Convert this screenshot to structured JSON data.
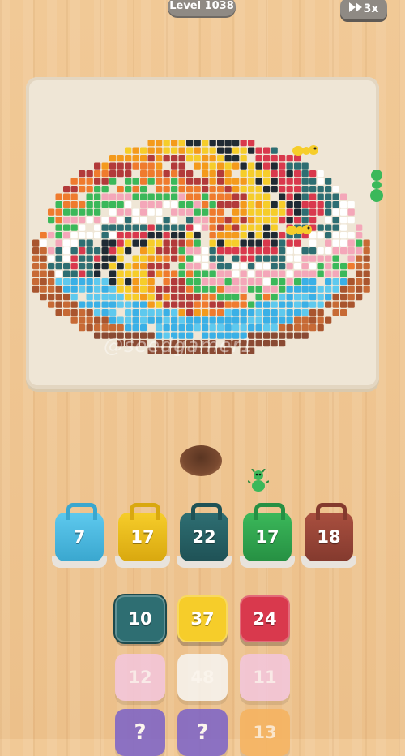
{
  "header": {
    "level_label": "Level 1038",
    "speed_label": "3x"
  },
  "board": {
    "watermark": "@seedgamer1"
  },
  "buckets": [
    {
      "count": "7",
      "color": "#5ec9ee",
      "dark": "#3aa7cf"
    },
    {
      "count": "17",
      "color": "#f6cd2a",
      "dark": "#d9a80f"
    },
    {
      "count": "22",
      "color": "#2e6e72",
      "dark": "#1f5256"
    },
    {
      "count": "17",
      "color": "#3bb85a",
      "dark": "#269043"
    },
    {
      "count": "18",
      "color": "#a94f3f",
      "dark": "#843a2e"
    }
  ],
  "queue": [
    {
      "count": "10",
      "color": "#2e6e72",
      "state": "active"
    },
    {
      "count": "37",
      "color": "#f6cd2a",
      "state": "active"
    },
    {
      "count": "24",
      "color": "#d9394d",
      "state": "active"
    },
    {
      "count": "12",
      "color": "#f4c6de",
      "state": "waiting"
    },
    {
      "count": "48",
      "color": "#f7f5f2",
      "state": "waiting"
    },
    {
      "count": "11",
      "color": "#f4c6de",
      "state": "waiting"
    },
    {
      "count": "?",
      "color": "#7b62c9",
      "state": "hidden"
    },
    {
      "count": "?",
      "color": "#7b62c9",
      "state": "hidden"
    },
    {
      "count": "13",
      "color": "#f6b35f",
      "state": "waiting"
    }
  ]
}
